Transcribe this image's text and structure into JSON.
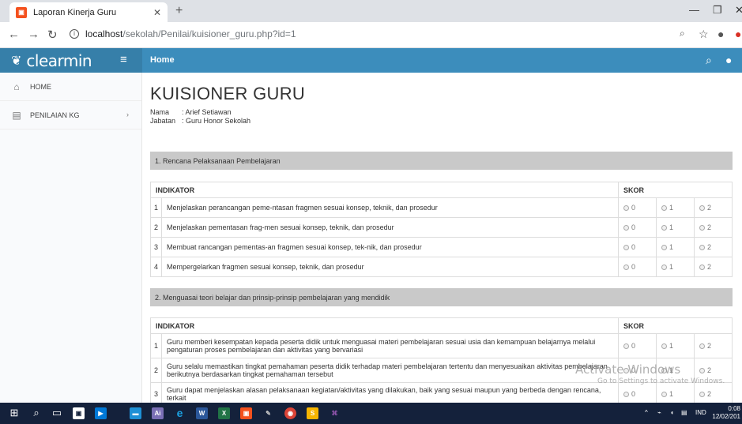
{
  "browser": {
    "tab_title": "Laporan Kinerja Guru",
    "url_host": "localhost",
    "url_path": "/sekolah/Penilai/kuisioner_guru.php?id=1"
  },
  "app": {
    "logo": "clearmin",
    "header_title": "Home",
    "accent_color": "#3c8dbc"
  },
  "sidebar": {
    "items": [
      {
        "label": "HOME",
        "icon": "home-icon"
      },
      {
        "label": "PENILAIAN KG",
        "icon": "table-icon"
      }
    ]
  },
  "page": {
    "title": "KUISIONER GURU",
    "nama_label": "Nama",
    "nama_value": ": Arief Setiawan",
    "jabatan_label": "Jabatan",
    "jabatan_value": ": Guru Honor Sekolah"
  },
  "sections": [
    {
      "title": "1. Rencana Pelaksanaan Pembelajaran",
      "col_indikator": "INDIKATOR",
      "col_skor": "SKOR",
      "options": [
        "0",
        "1",
        "2"
      ],
      "rows": [
        {
          "no": "1",
          "text": "Menjelaskan perancangan peme-ntasan fragmen sesuai konsep, teknik, dan prosedur"
        },
        {
          "no": "2",
          "text": "Menjelaskan pementasan frag-men sesuai konsep, teknik, dan prosedur"
        },
        {
          "no": "3",
          "text": "Membuat rancangan pementas-an fragmen sesuai konsep, tek-nik, dan prosedur"
        },
        {
          "no": "4",
          "text": "Mempergelarkan fragmen sesuai konsep, teknik, dan prosedur"
        }
      ]
    },
    {
      "title": "2. Menguasai teori belajar dan prinsip-prinsip pembelajaran yang mendidik",
      "col_indikator": "INDIKATOR",
      "col_skor": "SKOR",
      "options": [
        "0",
        "1",
        "2"
      ],
      "rows": [
        {
          "no": "1",
          "text": "Guru memberi kesempatan kepada peserta didik untuk menguasai materi pembelajaran sesuai usia dan kemampuan belajarnya melalui pengaturan proses pembelajaran dan aktivitas yang bervariasi"
        },
        {
          "no": "2",
          "text": "Guru selalu memastikan tingkat pemahaman peserta didik terhadap materi pembelajaran tertentu dan menyesuaikan aktivitas pembelajaran berikutnya berdasarkan tingkat pemahaman tersebut"
        },
        {
          "no": "3",
          "text": "Guru dapat menjelaskan alasan pelaksanaan kegiatan/aktivitas yang dilakukan, baik yang sesuai maupun yang berbeda dengan rencana, terkait"
        }
      ]
    }
  ],
  "watermark": {
    "line1": "Activate Windows",
    "line2": "Go to Settings to activate Windows."
  },
  "taskbar": {
    "lang": "IND",
    "time": "0:08",
    "date": "12/02/201"
  }
}
